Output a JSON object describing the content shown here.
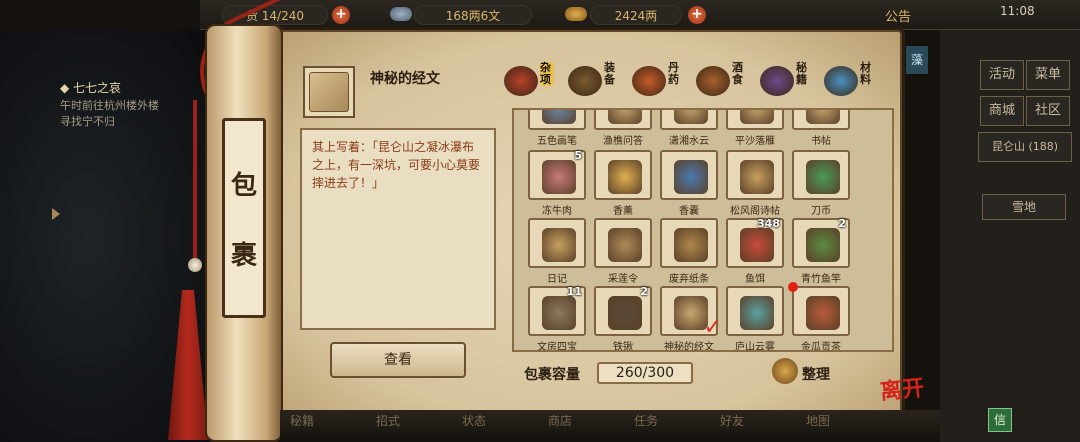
{
  "topbar": {
    "bag_count": "货 14/240",
    "copper": "168两6文",
    "silver": "2424两",
    "notice": "公告",
    "clock": "11:08"
  },
  "quest": {
    "title": "◆ 七七之哀",
    "line1": "午时前往杭州楼外楼",
    "line2": "寻找宁不归"
  },
  "right_panel": {
    "activity": "活动",
    "menu": "菜单",
    "shop": "商城",
    "community": "社区",
    "location": "昆仑山 (188)",
    "snow": "雪地",
    "edge_tab": "藻"
  },
  "scroll": {
    "title_top": "包",
    "title_bottom": "裹"
  },
  "selected_item": {
    "name": "神秘的经文",
    "description": "其上写着：「昆仑山之凝冰瀑布之上，有一深坑，可要小心莫要摔进去了！」",
    "view_button": "查看"
  },
  "categories": [
    {
      "label": "杂项",
      "active": true,
      "color": "#b8402a"
    },
    {
      "label": "装备",
      "active": false,
      "color": "#7a5a30"
    },
    {
      "label": "丹药",
      "active": false,
      "color": "#c85a2a"
    },
    {
      "label": "酒食",
      "active": false,
      "color": "#a86030"
    },
    {
      "label": "秘籍",
      "active": false,
      "color": "#6a4a8a"
    },
    {
      "label": "材料",
      "active": false,
      "color": "#4a90c0"
    }
  ],
  "inventory": {
    "rows": [
      [
        {
          "name": "五色画笔",
          "count": "",
          "color": "#6a8ab0"
        },
        {
          "name": "渔樵问答",
          "count": "",
          "color": "#c8a870"
        },
        {
          "name": "潇湘水云",
          "count": "",
          "color": "#c8a870"
        },
        {
          "name": "平沙落雁",
          "count": "",
          "color": "#c8a870"
        },
        {
          "name": "书帖",
          "count": "",
          "color": "#c8a870"
        }
      ],
      [
        {
          "name": "冻牛肉",
          "count": "5",
          "color": "#c87a7a"
        },
        {
          "name": "香薰",
          "count": "",
          "color": "#e0b050"
        },
        {
          "name": "香囊",
          "count": "",
          "color": "#4a7ab0"
        },
        {
          "name": "松风阁诗帖",
          "count": "",
          "color": "#c8a060"
        },
        {
          "name": "刀币",
          "count": "",
          "color": "#4a9a5a"
        }
      ],
      [
        {
          "name": "日记",
          "count": "",
          "color": "#c8a060"
        },
        {
          "name": "采莲令",
          "count": "",
          "color": "#b08a58"
        },
        {
          "name": "废弃纸条",
          "count": "",
          "color": "#b0884a"
        },
        {
          "name": "鱼饵",
          "count": "348",
          "color": "#c84a3a"
        },
        {
          "name": "青竹鱼竿",
          "count": "2",
          "color": "#5a8a40"
        }
      ],
      [
        {
          "name": "文房四宝",
          "count": "11",
          "color": "#8a7a60"
        },
        {
          "name": "铁锹",
          "count": "2",
          "color": "#5a4a38"
        },
        {
          "name": "神秘的经文",
          "count": "",
          "color": "#c8a870"
        },
        {
          "name": "庐山云雾",
          "count": "",
          "color": "#5aa0a0"
        },
        {
          "name": "金瓜贡茶",
          "count": "",
          "color": "#b85a3a"
        }
      ]
    ]
  },
  "capacity": {
    "label": "包裹容量",
    "value": "260/300"
  },
  "sort_button": "整理",
  "leave_button": "离开",
  "bottom_bar": [
    "秘籍",
    "招式",
    "状态",
    "商店",
    "任务",
    "好友",
    "地图"
  ],
  "mail": "信"
}
